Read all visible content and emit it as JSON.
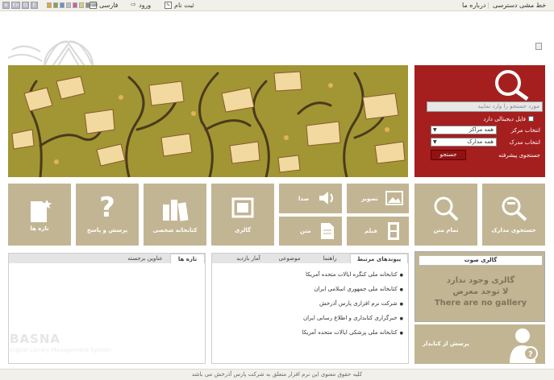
{
  "topbar": {
    "languages": [
      "e",
      "En",
      "G",
      "E"
    ],
    "swatches": [
      "#e8a23c",
      "#7aa84b",
      "#6c8fc7",
      "#c0c0c0",
      "#d45aa5",
      "#d9cf6e",
      "#8e8e8e"
    ],
    "persian": "فارسی",
    "login": "ورود",
    "register": "ثبت نام",
    "about": "درباره ما",
    "access_policy": "خط مشی دسترسی"
  },
  "search": {
    "placeholder": "مورد جستجو را وارد نمایید",
    "digital_file_label": "فایل دیجیتالی دارد",
    "center_label": "انتخاب مرکز",
    "center_value": "همه مراکز",
    "doc_label": "انتخاب مدرک",
    "doc_value": "همه مدارک",
    "advanced": "جستجوی پیشرفته",
    "button": "جستجو"
  },
  "tiles": {
    "latest": "تازه ها",
    "qa": "پرسش و پاسخ",
    "personal_library": "کتابخانه شخصی",
    "gallery": "گالری",
    "audio": "صدا",
    "image": "تصویر",
    "text": "متن",
    "film": "فیلم",
    "full_text": "تمام متن",
    "doc_search": "جستجوی مدارک"
  },
  "left_panel": {
    "tabs": [
      "تازه ها",
      "عناوین برجسته"
    ]
  },
  "mid_panel": {
    "tabs": [
      "پیوندهای مرتبط",
      "راهنما",
      "موضوعی",
      "آمار بازدید"
    ],
    "links": [
      "کتابخانه ملی کنگره ایالات متحده آمریکا",
      "کتابخانه ملی جمهوری اسلامی ایران",
      "شرکت نرم افزاری پارس آذرخش",
      "خبرگزاری کتابداری و اطلاع رسانی ایران",
      "کتابخانه ملی پزشکی ایالات متحده آمریکا"
    ]
  },
  "gallery": {
    "title": "گالری صوت",
    "msg1": "گالری وجود ندارد",
    "msg2": "لا توجد معرض",
    "msg3": "There are no gallery"
  },
  "ask": {
    "label": "پرسش از کتابدار"
  },
  "watermark": {
    "title": "BASNA",
    "subtitle": "Digital Library Management System"
  },
  "footer": {
    "copyright": "کلیه حقوق معنوی این نرم افزار متعلق به شرکت پارس آذرخش می باشد"
  }
}
